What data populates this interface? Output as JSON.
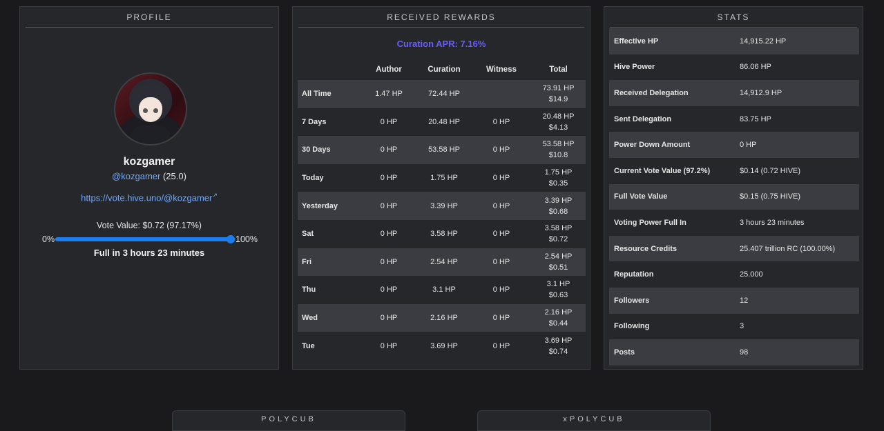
{
  "profile": {
    "title": "PROFILE",
    "username": "kozgamer",
    "handle": "@kozgamer",
    "reputation": "(25.0)",
    "vote_link": "https://vote.hive.uno/@kozgamer",
    "vote_value": "Vote Value: $0.72 (97.17%)",
    "slider_min": "0%",
    "slider_max": "100%",
    "voting_power_fraction": 0.9717,
    "full_in": "Full in 3 hours 23 minutes"
  },
  "rewards": {
    "title": "RECEIVED REWARDS",
    "apr": "Curation APR: 7.16%",
    "headers": [
      "",
      "Author",
      "Curation",
      "Witness",
      "Total"
    ],
    "rows": [
      {
        "label": "All Time",
        "author": "1.47 HP",
        "curation": "72.44 HP",
        "witness": "",
        "total_hp": "73.91 HP",
        "total_usd": "$14.9"
      },
      {
        "label": "7 Days",
        "author": "0 HP",
        "curation": "20.48 HP",
        "witness": "0 HP",
        "total_hp": "20.48 HP",
        "total_usd": "$4.13"
      },
      {
        "label": "30 Days",
        "author": "0 HP",
        "curation": "53.58 HP",
        "witness": "0 HP",
        "total_hp": "53.58 HP",
        "total_usd": "$10.8"
      },
      {
        "label": "Today",
        "author": "0 HP",
        "curation": "1.75 HP",
        "witness": "0 HP",
        "total_hp": "1.75 HP",
        "total_usd": "$0.35"
      },
      {
        "label": "Yesterday",
        "author": "0 HP",
        "curation": "3.39 HP",
        "witness": "0 HP",
        "total_hp": "3.39 HP",
        "total_usd": "$0.68"
      },
      {
        "label": "Sat",
        "author": "0 HP",
        "curation": "3.58 HP",
        "witness": "0 HP",
        "total_hp": "3.58 HP",
        "total_usd": "$0.72"
      },
      {
        "label": "Fri",
        "author": "0 HP",
        "curation": "2.54 HP",
        "witness": "0 HP",
        "total_hp": "2.54 HP",
        "total_usd": "$0.51"
      },
      {
        "label": "Thu",
        "author": "0 HP",
        "curation": "3.1 HP",
        "witness": "0 HP",
        "total_hp": "3.1 HP",
        "total_usd": "$0.63"
      },
      {
        "label": "Wed",
        "author": "0 HP",
        "curation": "2.16 HP",
        "witness": "0 HP",
        "total_hp": "2.16 HP",
        "total_usd": "$0.44"
      },
      {
        "label": "Tue",
        "author": "0 HP",
        "curation": "3.69 HP",
        "witness": "0 HP",
        "total_hp": "3.69 HP",
        "total_usd": "$0.74"
      }
    ]
  },
  "stats": {
    "title": "STATS",
    "rows": [
      {
        "key": "Effective HP",
        "value": "14,915.22 HP"
      },
      {
        "key": "Hive Power",
        "value": "86.06 HP"
      },
      {
        "key": "Received Delegation",
        "value": "14,912.9 HP"
      },
      {
        "key": "Sent Delegation",
        "value": "83.75 HP"
      },
      {
        "key": "Power Down Amount",
        "value": "0 HP"
      },
      {
        "key": "Current Vote Value (97.2%)",
        "value": "$0.14 (0.72 HIVE)"
      },
      {
        "key": "Full Vote Value",
        "value": "$0.15 (0.75 HIVE)"
      },
      {
        "key": "Voting Power Full In",
        "value": "3 hours 23 minutes"
      },
      {
        "key": "Resource Credits",
        "value": "25.407 trillion RC (100.00%)"
      },
      {
        "key": "Reputation",
        "value": "25.000"
      },
      {
        "key": "Followers",
        "value": "12"
      },
      {
        "key": "Following",
        "value": "3"
      },
      {
        "key": "Posts",
        "value": "98"
      }
    ]
  },
  "tabs": {
    "polycub": "POLYCUB",
    "xpolycub": "xPOLYCUB"
  },
  "icons": {
    "external_link": "external-link-icon",
    "avatar": "avatar"
  },
  "colors": {
    "accent_blue": "#1a7ef0",
    "link_blue": "#6ea8ff",
    "apr_purple": "#6a5cff"
  }
}
